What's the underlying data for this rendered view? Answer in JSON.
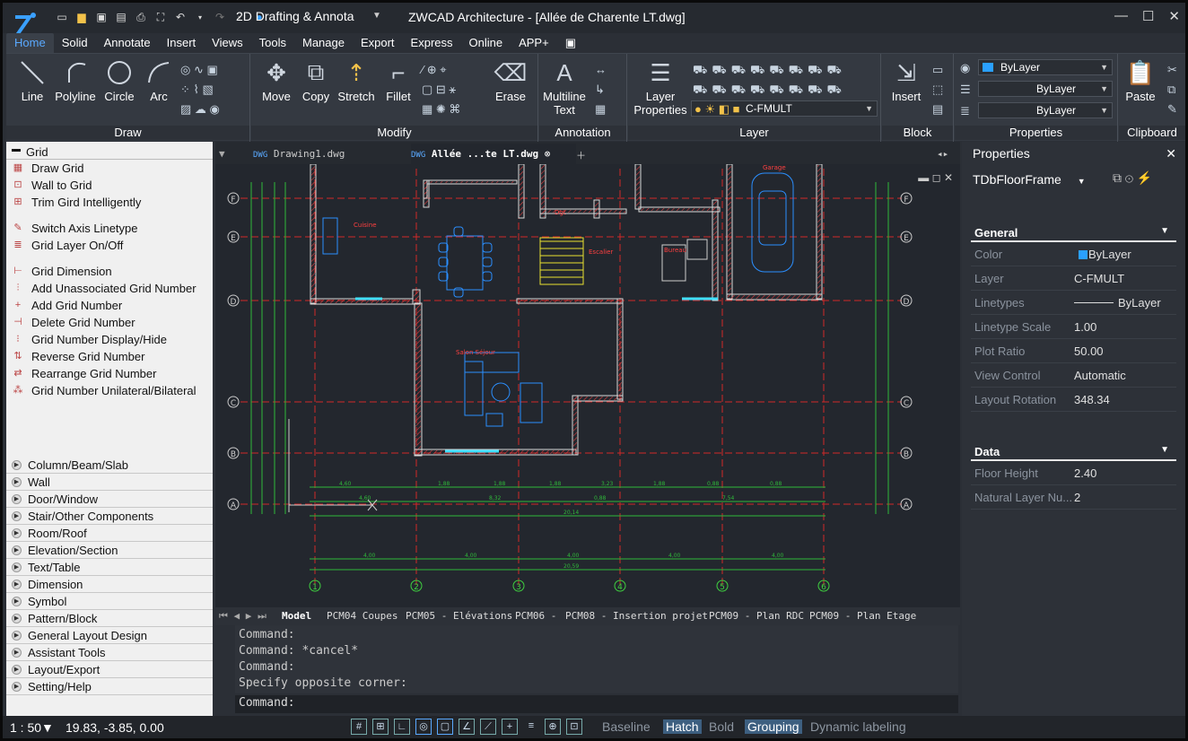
{
  "app": {
    "title": "ZWCAD Architecture - [Allée de Charente LT.dwg]",
    "workspace": "2D Drafting & Annota"
  },
  "menu": [
    "Home",
    "Solid",
    "Annotate",
    "Insert",
    "Views",
    "Tools",
    "Manage",
    "Export",
    "Express",
    "Online",
    "APP+"
  ],
  "ribbon": {
    "draw": {
      "label": "Draw",
      "buttons": [
        "Line",
        "Polyline",
        "Circle",
        "Arc"
      ]
    },
    "modify": {
      "label": "Modify",
      "buttons": [
        "Move",
        "Copy",
        "Stretch",
        "Fillet",
        "Erase"
      ]
    },
    "annotation": {
      "label": "Annotation",
      "multiline": "Multiline",
      "text": "Text"
    },
    "layer": {
      "label": "Layer",
      "props": "Layer",
      "props2": "Properties",
      "current": "C-FMULT"
    },
    "block": {
      "label": "Block",
      "insert": "Insert"
    },
    "properties": {
      "label": "Properties",
      "color": "ByLayer",
      "linetype": "ByLayer",
      "lineweight": "ByLayer"
    },
    "clipboard": {
      "label": "Clipboard",
      "paste": "Paste"
    }
  },
  "left": {
    "head": "Grid",
    "items": [
      "Draw Grid",
      "Wall to Grid",
      "Trim Gird Intelligently",
      "Switch Axis Linetype",
      "Grid Layer On/Off",
      "Grid Dimension",
      "Add Unassociated Grid Number",
      "Add Grid Number",
      "Delete Grid Number",
      "Grid Number Display/Hide",
      "Reverse Grid Number",
      "Rearrange Grid Number",
      "Grid Number Unilateral/Bilateral"
    ],
    "cats": [
      "Column/Beam/Slab",
      "Wall",
      "Door/Window",
      "Stair/Other Components",
      "Room/Roof",
      "Elevation/Section",
      "Text/Table",
      "Dimension",
      "Symbol",
      "Pattern/Block",
      "General Layout Design",
      "Assistant Tools",
      "Layout/Export",
      "Setting/Help"
    ]
  },
  "docs": {
    "tab1": "Drawing1.dwg",
    "tab2": "Allée ...te LT.dwg"
  },
  "layouts": [
    "Model",
    "PCM04 Coupes",
    "PCM05 - Elévations",
    "PCM06 -",
    "PCM08 - Insertion projet",
    "PCM09 - Plan RDC",
    "PCM09 - Plan Etage"
  ],
  "cmd": {
    "lines": [
      "Command:",
      "Command: *cancel*",
      "Command:",
      "Specify opposite corner:"
    ],
    "prompt": "Command:"
  },
  "props": {
    "title": "Properties",
    "object": "TDbFloorFrame",
    "general": "General",
    "rows": [
      [
        "Color",
        "ByLayer"
      ],
      [
        "Layer",
        "C-FMULT"
      ],
      [
        "Linetypes",
        "ByLayer"
      ],
      [
        "Linetype Scale",
        "1.00"
      ],
      [
        "Plot Ratio",
        "50.00"
      ],
      [
        "View Control",
        "Automatic"
      ],
      [
        "Layout Rotation",
        "348.34"
      ]
    ],
    "data": "Data",
    "drows": [
      [
        "Floor Height",
        "2.40"
      ],
      [
        "Natural Layer Nu...",
        "2"
      ]
    ]
  },
  "drawing": {
    "rows": [
      "F",
      "E",
      "D",
      "C",
      "B",
      "A"
    ],
    "cols": [
      "1",
      "2",
      "3",
      "4",
      "5",
      "6"
    ],
    "rooms": [
      "Cuisine",
      "Salon Séjour",
      "Dgt",
      "Garage",
      "Bureau",
      "Escalier"
    ],
    "dims_top": [
      "4,60",
      "1,88",
      "1,88",
      "1,88",
      "3,23",
      "1,88",
      "0,88",
      "0,88"
    ],
    "dims_mid": [
      "4,60",
      "8,32",
      "0,88",
      "7,54"
    ],
    "total": "20,14",
    "dims_bot": [
      "4,00",
      "4,00",
      "4,00",
      "4,00",
      "4,00"
    ],
    "total2": "20,59"
  },
  "status": {
    "scale": "1 : 50▼",
    "coords": "19.83, -3.85, 0.00",
    "baseline": "Baseline",
    "hatch": "Hatch",
    "bold": "Bold",
    "grouping": "Grouping",
    "dynamic": "Dynamic labeling"
  }
}
